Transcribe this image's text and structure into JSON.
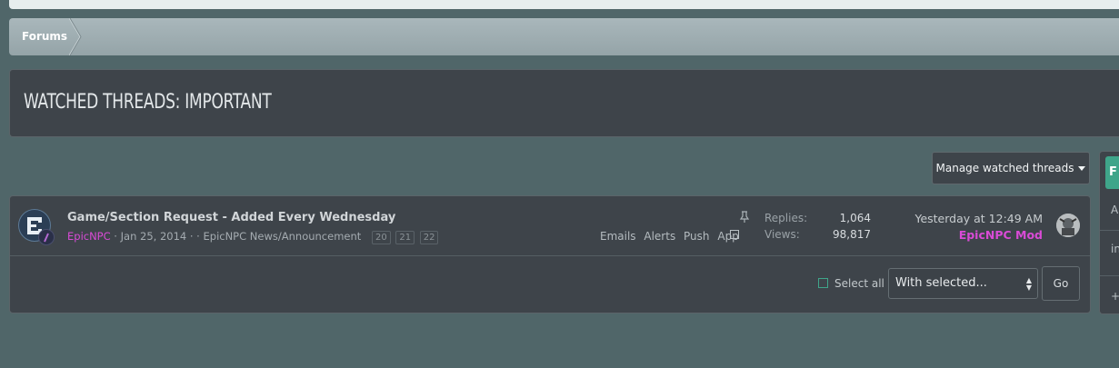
{
  "breadcrumb": {
    "item": "Forums"
  },
  "page": {
    "title": "WATCHED THREADS: IMPORTANT"
  },
  "toolbar": {
    "manage_label": "Manage watched threads"
  },
  "sidebar": {
    "button_label": "F",
    "line1": "A",
    "line2": "in",
    "line3": "+"
  },
  "threads": [
    {
      "title": "Game/Section Request - Added Every Wednesday",
      "author": "EpicNPC",
      "date": "Jan 25, 2014",
      "separator": " · ",
      "forum": "· · EpicNPC News/Announcement",
      "pages": [
        "20",
        "21",
        "22"
      ],
      "notify": [
        "Emails",
        "Alerts",
        "Push",
        "App"
      ],
      "replies_label": "Replies:",
      "replies": "1,064",
      "views_label": "Views:",
      "views": "98,817",
      "last_date": "Yesterday at 12:49 AM",
      "last_user": "EpicNPC Mod"
    }
  ],
  "footer": {
    "select_all": "Select all",
    "with_selected": "With selected...",
    "go": "Go"
  },
  "colors": {
    "background": "#506669",
    "panel": "#3e444a",
    "username": "#d94bd6",
    "accent_green": "#3fa58a"
  }
}
